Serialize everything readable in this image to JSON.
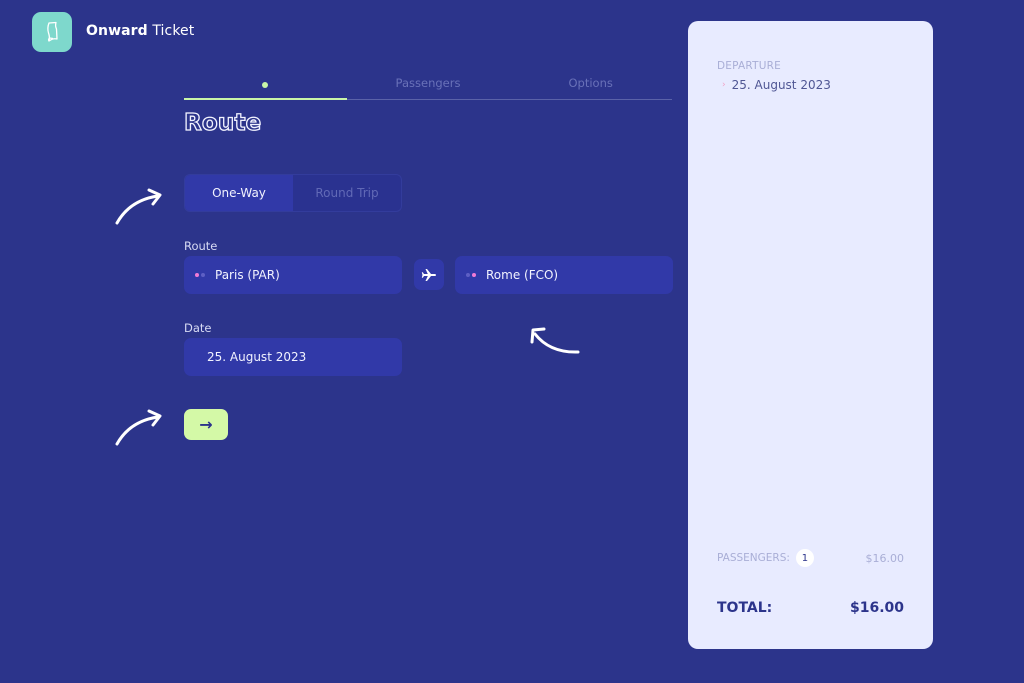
{
  "app": {
    "brand_bold": "Onward",
    "brand_light": " Ticket",
    "logo_icon": "ticket-icon"
  },
  "steps": [
    {
      "label": "",
      "indicator": "dot",
      "active": true
    },
    {
      "label": "Passengers",
      "active": false
    },
    {
      "label": "Options",
      "active": false
    }
  ],
  "page_title": "Route",
  "trip_type": {
    "options": [
      "One-Way",
      "Round Trip"
    ],
    "selected": "One-Way"
  },
  "route": {
    "label": "Route",
    "from": "Paris (PAR)",
    "to": "Rome (FCO)",
    "swap_icon": "airplane-icon"
  },
  "date": {
    "label": "Date",
    "value": "25. August 2023"
  },
  "next_button": {
    "label": "→"
  },
  "summary": {
    "departure_label": "DEPARTURE",
    "departure_value": "25. August 2023",
    "passengers_label": "PASSENGERS:",
    "passengers_count": "1",
    "passengers_price": "$16.00",
    "total_label": "TOTAL:",
    "total_value": "$16.00"
  },
  "colors": {
    "background": "#2c348b",
    "accent": "#d4f9a7",
    "input": "#3139a8",
    "panel": "#e8ebff",
    "logo": "#7ed8cc",
    "dot_pink": "#f07bd6"
  }
}
